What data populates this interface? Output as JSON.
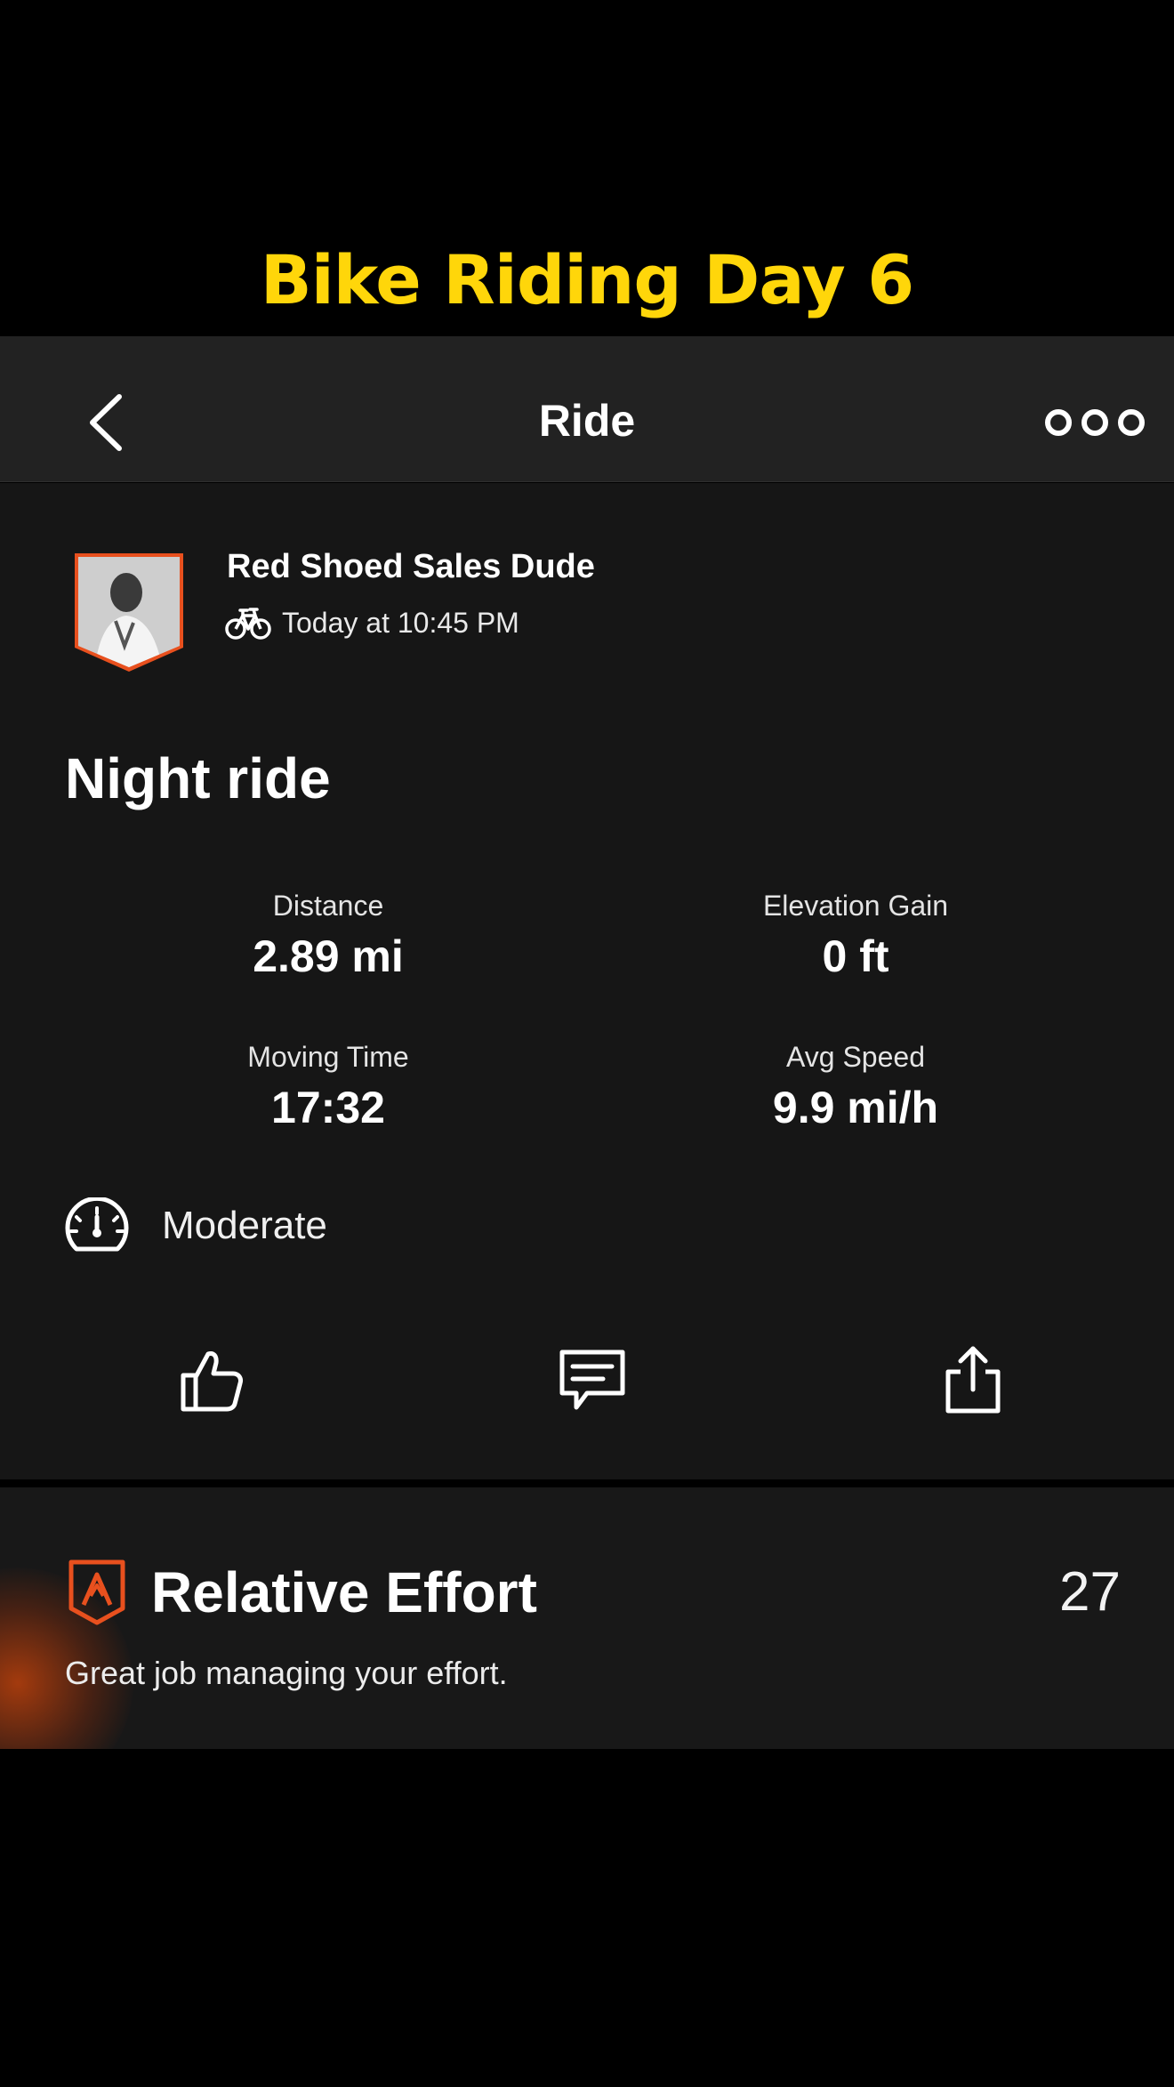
{
  "overlay": {
    "title": "Bike Riding Day 6",
    "color": "#ffd60a"
  },
  "navbar": {
    "title": "Ride",
    "back_icon": "chevron-left-icon",
    "more_icon": "more-horizontal-icon"
  },
  "athlete": {
    "name": "Red Shoed Sales Dude",
    "timestamp": "Today at 10:45 PM",
    "activity_icon": "bike-icon"
  },
  "activity": {
    "title": "Night ride"
  },
  "stats": [
    {
      "label": "Distance",
      "value": "2.89 mi"
    },
    {
      "label": "Elevation Gain",
      "value": "0 ft"
    },
    {
      "label": "Moving Time",
      "value": "17:32"
    },
    {
      "label": "Avg Speed",
      "value": "9.9 mi/h"
    }
  ],
  "effort": {
    "label": "Moderate",
    "icon": "gauge-icon"
  },
  "actions": [
    {
      "name": "kudos",
      "icon": "thumbs-up-icon"
    },
    {
      "name": "comment",
      "icon": "comment-icon"
    },
    {
      "name": "share",
      "icon": "share-icon"
    }
  ],
  "relative_effort": {
    "title": "Relative Effort",
    "score": "27",
    "subtitle": "Great job managing your effort.",
    "accent": "#e8501e"
  }
}
